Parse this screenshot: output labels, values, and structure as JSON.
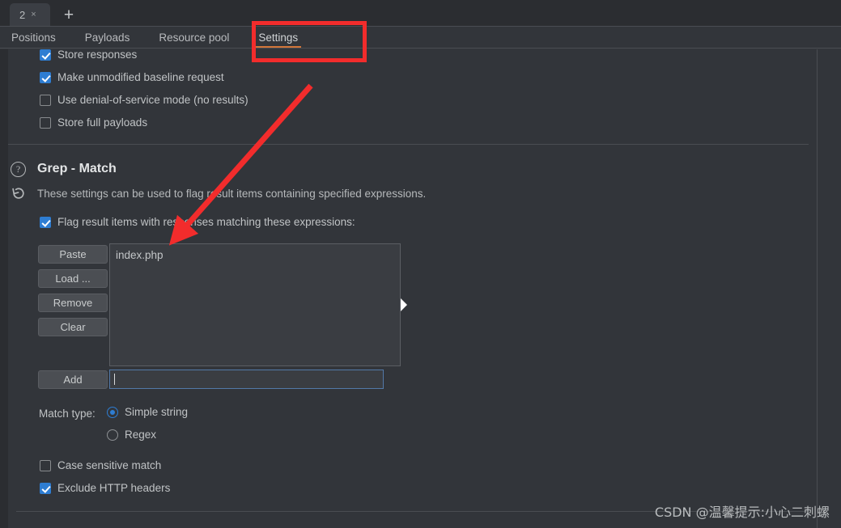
{
  "window": {
    "tab": {
      "label": "2",
      "close": "×"
    },
    "new_tab": "+"
  },
  "subtabs": [
    {
      "label": "Positions",
      "active": false
    },
    {
      "label": "Payloads",
      "active": false
    },
    {
      "label": "Resource pool",
      "active": false
    },
    {
      "label": "Settings",
      "active": true
    }
  ],
  "request_options": [
    {
      "label": "Store responses",
      "checked": true
    },
    {
      "label": "Make unmodified baseline request",
      "checked": true
    },
    {
      "label": "Use denial-of-service mode (no results)",
      "checked": false
    },
    {
      "label": "Store full payloads",
      "checked": false
    }
  ],
  "grep_match": {
    "help_icon": "question-mark-icon",
    "reset_icon": "reset-arrow-icon",
    "title": "Grep - Match",
    "description": "These settings can be used to flag result items containing specified expressions.",
    "flag_checkbox": {
      "label": "Flag result items with responses matching these expressions:",
      "checked": true
    },
    "buttons": [
      {
        "label": "Paste"
      },
      {
        "label": "Load ..."
      },
      {
        "label": "Remove"
      },
      {
        "label": "Clear"
      }
    ],
    "add_button": {
      "label": "Add"
    },
    "expressions": [
      "index.php"
    ],
    "add_input": {
      "value": "",
      "placeholder": ""
    },
    "match_type": {
      "label": "Match type:",
      "options": [
        {
          "label": "Simple string",
          "selected": true
        },
        {
          "label": "Regex",
          "selected": false
        }
      ]
    },
    "options": [
      {
        "label": "Case sensitive match",
        "checked": false
      },
      {
        "label": "Exclude HTTP headers",
        "checked": true
      }
    ]
  },
  "annotations": {
    "highlight_target": "Settings",
    "arrow_color": "#f22c2c",
    "rect_color": "#f22c2c"
  },
  "watermark": "CSDN @温馨提示:小心二刺螺"
}
